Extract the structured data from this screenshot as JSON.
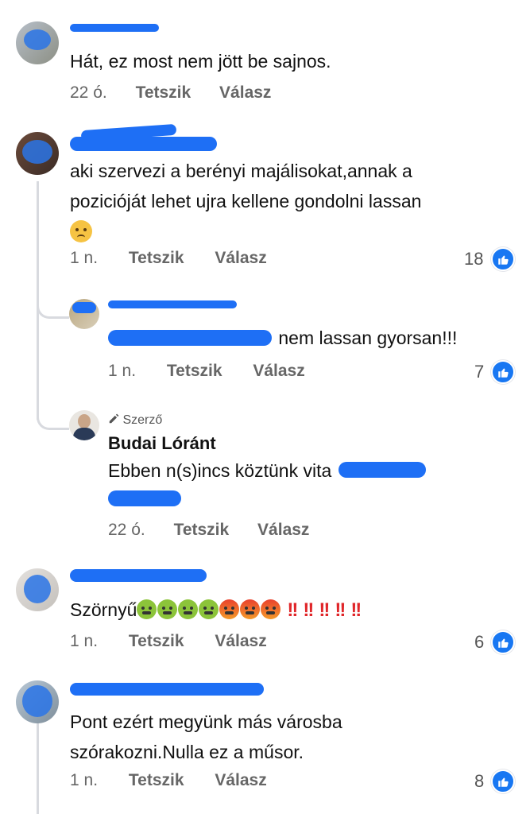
{
  "comments": [
    {
      "text": "Hát, ez most nem jött be sajnos.",
      "time": "22 ó."
    },
    {
      "text_lines": [
        "aki szervezi a berényi majálisokat,annak a",
        "pozicióját lehet ujra kellene gondolni lassan"
      ],
      "time": "1 n.",
      "reaction_count": "18"
    },
    {
      "text": "nem lassan gyorsan!!!",
      "time": "1 n.",
      "reaction_count": "7"
    },
    {
      "badge": "Szerző",
      "name": "Budai Lóránt",
      "text": "Ebben n(s)incs köztünk vita",
      "time": "22 ó."
    },
    {
      "text": "Szörnyű",
      "time": "1 n.",
      "reaction_count": "6"
    },
    {
      "text_lines": [
        "Pont ezért megyünk más városba",
        "szórakozni.Nulla ez a műsor."
      ],
      "time": "1 n.",
      "reaction_count": "8"
    }
  ],
  "actions": {
    "like": "Tetszik",
    "reply": "Válasz"
  },
  "icons": {
    "like_badge": "thumbs-up-icon",
    "author_badge": "pencil-icon",
    "sad_emoji": "frowning-face-icon",
    "sick_emoji": "nauseated-face-icon",
    "angry_emoji": "angry-face-icon",
    "exclamation": "double-exclamation-icon"
  },
  "colors": {
    "redaction": "#1e6ff5",
    "like": "#1877f2",
    "meta": "#666666",
    "thread_line": "#d8dadf"
  }
}
